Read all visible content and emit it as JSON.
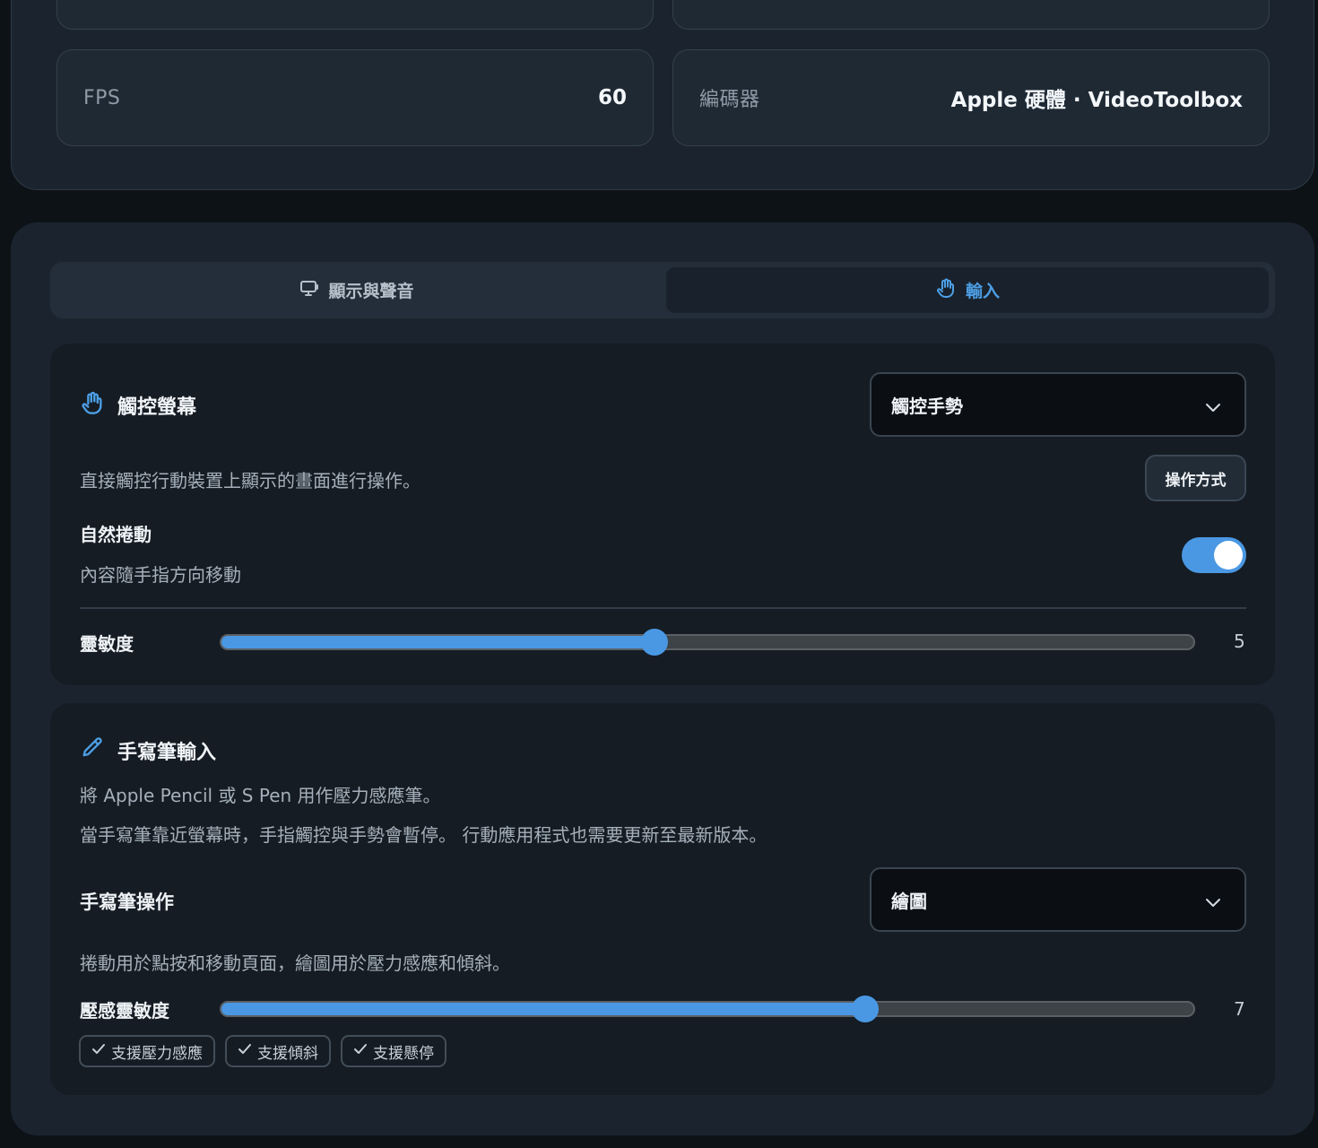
{
  "stream_info": {
    "fps_label": "FPS",
    "fps_value": "60",
    "encoder_label": "編碼器",
    "encoder_value": "Apple 硬體 · VideoToolbox"
  },
  "tabs": [
    {
      "label": "顯示與聲音",
      "icon": "monitor-icon",
      "active": false
    },
    {
      "label": "輸入",
      "icon": "hand-icon",
      "active": true
    }
  ],
  "touch_section": {
    "title": "觸控螢幕",
    "icon": "hand-icon",
    "mode_select": "觸控手勢",
    "description": "直接觸控行動裝置上顯示的畫面進行操作。",
    "how_to_button": "操作方式",
    "natural_scroll": {
      "label": "自然捲動",
      "description": "內容隨手指方向移動",
      "enabled": true
    },
    "sensitivity": {
      "label": "靈敏度",
      "value": "5",
      "fraction": 0.446
    }
  },
  "pen_section": {
    "title": "手寫筆輸入",
    "icon": "pencil-icon",
    "description_line1": "將 Apple Pencil 或 S Pen 用作壓力感應筆。",
    "description_line2": "當手寫筆靠近螢幕時，手指觸控與手勢會暫停。 行動應用程式也需要更新至最新版本。",
    "action_label": "手寫筆操作",
    "action_select": "繪圖",
    "action_description": "捲動用於點按和移動頁面，繪圖用於壓力感應和傾斜。",
    "pressure": {
      "label": "壓感靈敏度",
      "value": "7",
      "fraction": 0.662
    },
    "chips": [
      "支援壓力感應",
      "支援傾斜",
      "支援懸停"
    ]
  },
  "colors": {
    "accent": "#4a98e3",
    "panel": "#1b242e",
    "section": "#151c24",
    "page": "#0d1217"
  }
}
